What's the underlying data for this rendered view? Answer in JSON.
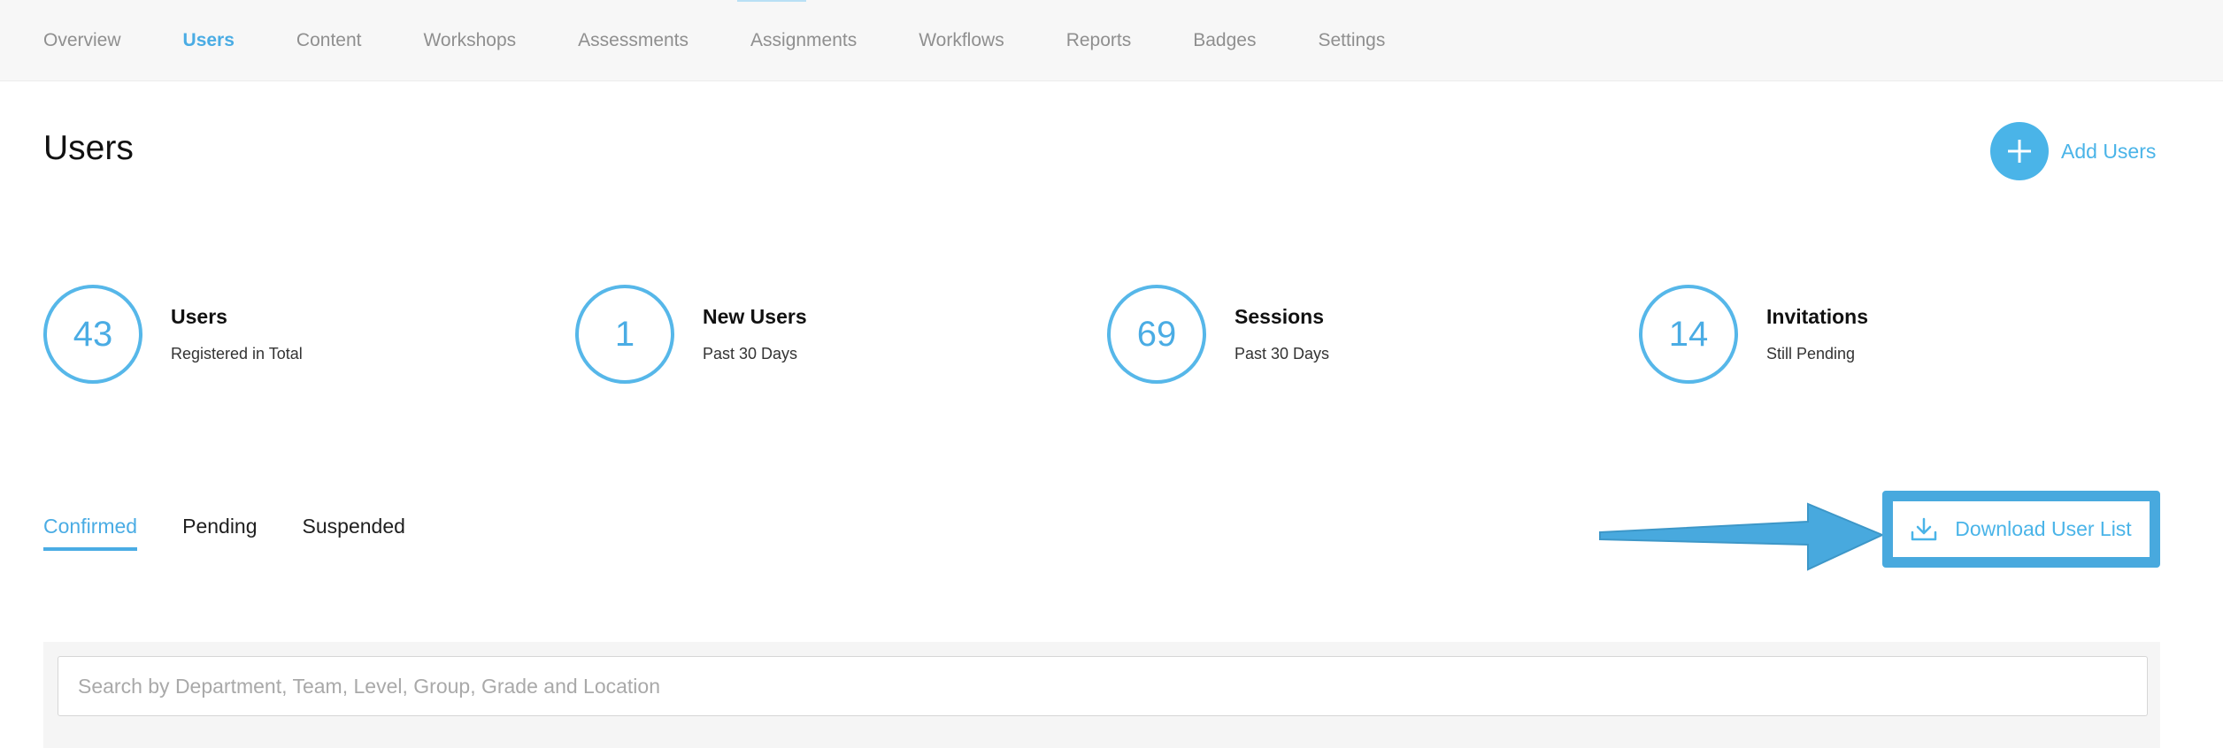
{
  "nav": {
    "items": [
      {
        "label": "Overview",
        "active": false
      },
      {
        "label": "Users",
        "active": true
      },
      {
        "label": "Content",
        "active": false
      },
      {
        "label": "Workshops",
        "active": false
      },
      {
        "label": "Assessments",
        "active": false
      },
      {
        "label": "Assignments",
        "active": false
      },
      {
        "label": "Workflows",
        "active": false
      },
      {
        "label": "Reports",
        "active": false
      },
      {
        "label": "Badges",
        "active": false
      },
      {
        "label": "Settings",
        "active": false
      }
    ]
  },
  "header": {
    "title": "Users",
    "add_label": "Add Users"
  },
  "stats": [
    {
      "value": "43",
      "title": "Users",
      "subtitle": "Registered in Total"
    },
    {
      "value": "1",
      "title": "New Users",
      "subtitle": "Past 30 Days"
    },
    {
      "value": "69",
      "title": "Sessions",
      "subtitle": "Past 30 Days"
    },
    {
      "value": "14",
      "title": "Invitations",
      "subtitle": "Still Pending"
    }
  ],
  "tabs": [
    {
      "label": "Confirmed",
      "active": true
    },
    {
      "label": "Pending",
      "active": false
    },
    {
      "label": "Suspended",
      "active": false
    }
  ],
  "download": {
    "label": "Download User List",
    "icon": "download-icon"
  },
  "search": {
    "value": "",
    "placeholder": "Search by Department, Team, Level, Group, Grade and Location"
  },
  "colors": {
    "accent": "#4aace4",
    "annotation": "#48a9de"
  }
}
